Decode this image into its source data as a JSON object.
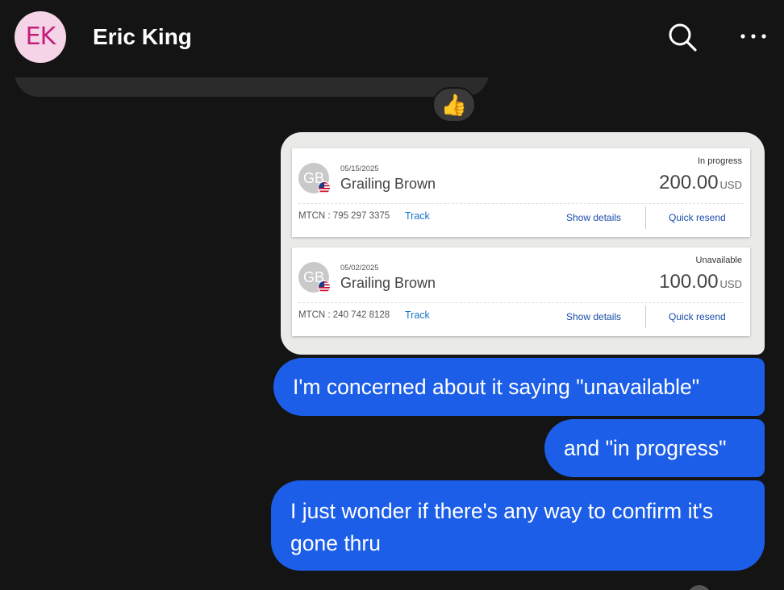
{
  "header": {
    "avatar_initials": "EK",
    "contact_name": "Eric King",
    "search_icon": "search-icon",
    "more_icon": "more-options-icon"
  },
  "reaction": {
    "emoji": "👍"
  },
  "transactions": [
    {
      "avatar_initials": "GB",
      "date": "05/15/2025",
      "name": "Grailing Brown",
      "status": "In progress",
      "amount": "200.00",
      "currency": "USD",
      "mtcn": "MTCN : 795 297 3375",
      "track_label": "Track",
      "show_details_label": "Show details",
      "quick_resend_label": "Quick resend"
    },
    {
      "avatar_initials": "GB",
      "date": "05/02/2025",
      "name": "Grailing Brown",
      "status": "Unavailable",
      "amount": "100.00",
      "currency": "USD",
      "mtcn": "MTCN : 240 742 8128",
      "track_label": "Track",
      "show_details_label": "Show details",
      "quick_resend_label": "Quick resend"
    }
  ],
  "messages": [
    {
      "text": "I'm concerned about it saying \"unavailable\""
    },
    {
      "text": "and \"in progress\""
    },
    {
      "text": "I just wonder if there's any way to confirm it's gone thru"
    }
  ],
  "colors": {
    "background": "#141414",
    "outgoing_bubble": "#1c5ee8",
    "avatar_bg": "#f6d4e8",
    "avatar_text": "#c21f79",
    "link_blue": "#1a73c9"
  }
}
